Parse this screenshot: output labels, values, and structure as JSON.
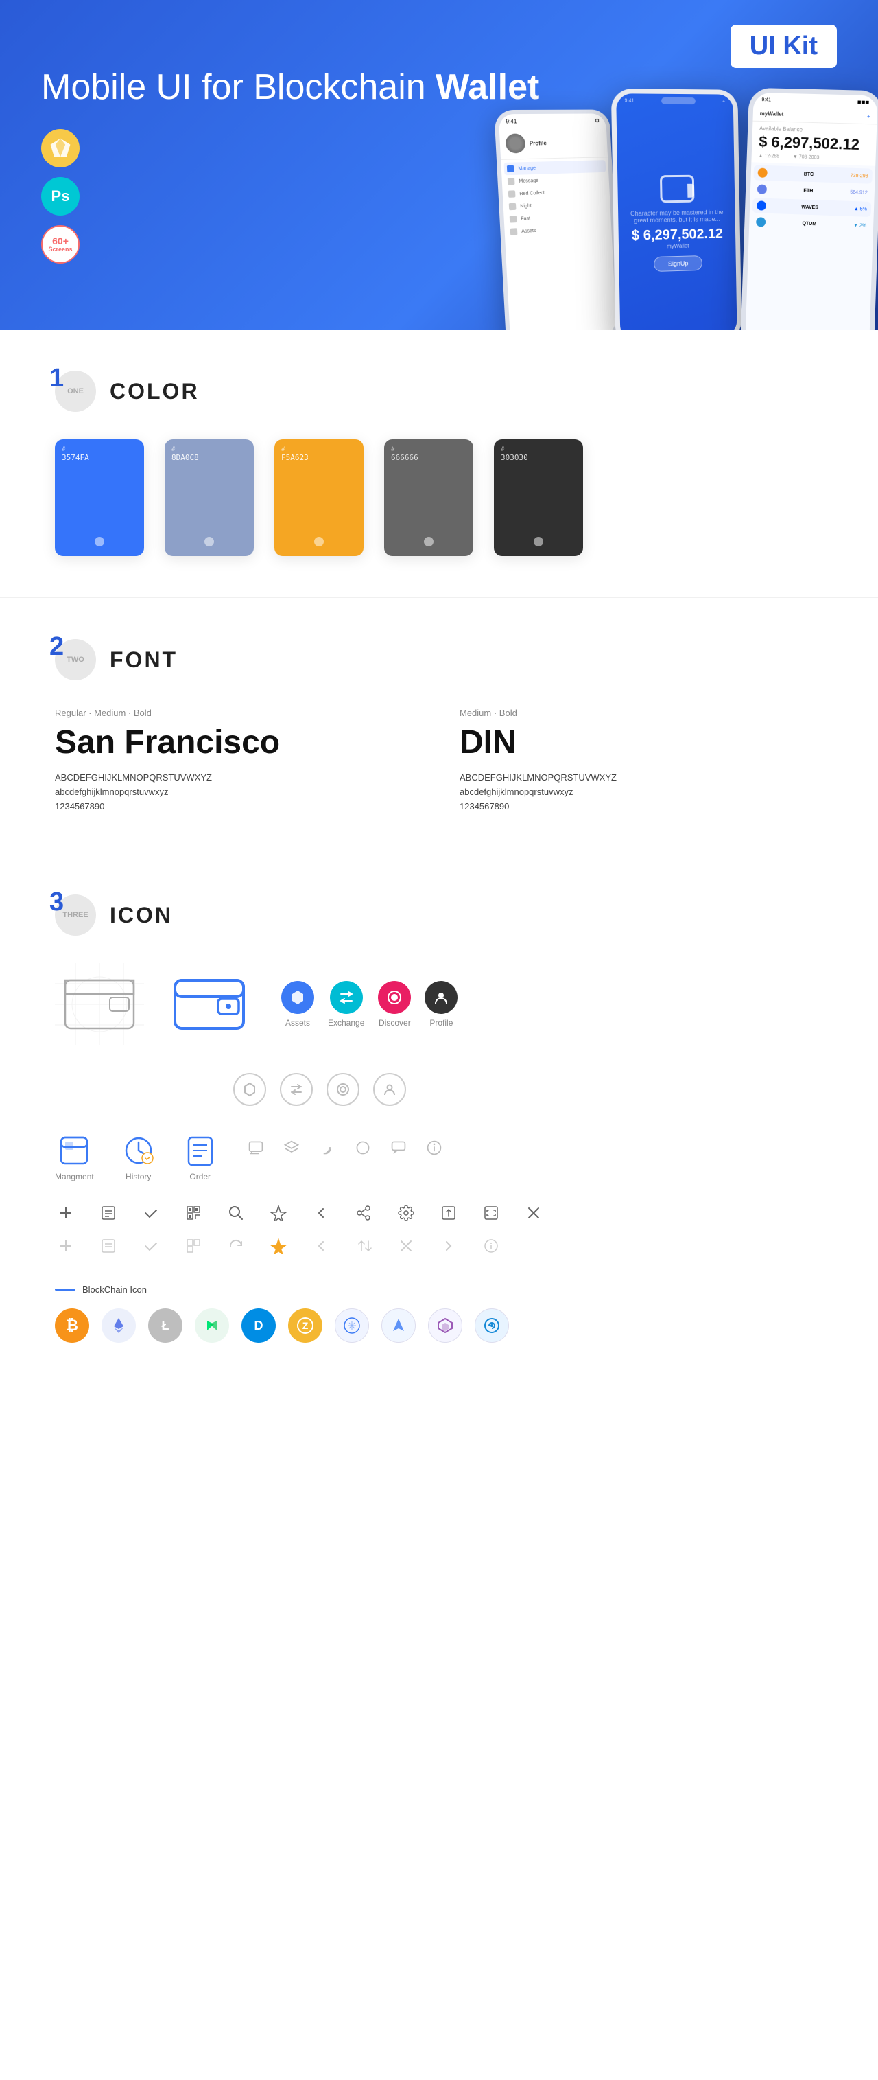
{
  "hero": {
    "title_part1": "Mobile UI for Blockchain ",
    "title_bold": "Wallet",
    "uikit_label": "UI Kit",
    "badge_sketch": "Sk",
    "badge_ps": "Ps",
    "badge_screens_num": "60+",
    "badge_screens_label": "Screens",
    "phone_main_amount": "$ 6,297,502.12",
    "phone_main_wallet_label": "myWallet",
    "phone_signup": "SignUp"
  },
  "sections": {
    "color": {
      "number": "1",
      "word": "ONE",
      "title": "COLOR",
      "swatches": [
        {
          "hex": "#3574FA",
          "label": "#\n3574FA",
          "bg": "#3574FA"
        },
        {
          "hex": "#8DA0C8",
          "label": "#\n8DA0C8",
          "bg": "#8DA0C8"
        },
        {
          "hex": "#F5A623",
          "label": "#\nF5A623",
          "bg": "#F5A623"
        },
        {
          "hex": "#666666",
          "label": "#\n666666",
          "bg": "#666666"
        },
        {
          "hex": "#303030",
          "label": "#\n303030",
          "bg": "#303030"
        }
      ]
    },
    "font": {
      "number": "2",
      "word": "TWO",
      "title": "FONT",
      "fonts": [
        {
          "style": "Regular · Medium · Bold",
          "name": "San Francisco",
          "upper": "ABCDEFGHIJKLMNOPQRSTUVWXYZ",
          "lower": "abcdefghijklmnopqrstuvwxyz",
          "nums": "1234567890"
        },
        {
          "style": "Medium · Bold",
          "name": "DIN",
          "upper": "ABCDEFGHIJKLMNOPQRSTUVWXYZ",
          "lower": "abcdefghijklmnopqrstuvwxyz",
          "nums": "1234567890"
        }
      ]
    },
    "icon": {
      "number": "3",
      "word": "THREE",
      "title": "ICON",
      "nav_icons": [
        {
          "label": "Mangment"
        },
        {
          "label": "History"
        },
        {
          "label": "Order"
        }
      ],
      "top_icons": [
        {
          "label": "Assets"
        },
        {
          "label": "Exchange"
        },
        {
          "label": "Discover"
        },
        {
          "label": "Profile"
        }
      ],
      "blockchain_label": "BlockChain Icon",
      "crypto_icons": [
        {
          "symbol": "₿",
          "class": "crypto-btc",
          "name": "Bitcoin"
        },
        {
          "symbol": "Ξ",
          "class": "crypto-eth",
          "name": "Ethereum"
        },
        {
          "symbol": "Ł",
          "class": "crypto-ltc",
          "name": "Litecoin"
        },
        {
          "symbol": "N",
          "class": "crypto-neo",
          "name": "Neo"
        },
        {
          "symbol": "D",
          "class": "crypto-dash",
          "name": "Dash"
        },
        {
          "symbol": "Z",
          "class": "crypto-zcash",
          "name": "Zcash"
        },
        {
          "symbol": "◆",
          "class": "crypto-iota",
          "name": "IOTA"
        },
        {
          "symbol": "▲",
          "class": "crypto-ark",
          "name": "Ark"
        },
        {
          "symbol": "P",
          "class": "crypto-polymath",
          "name": "Polymath"
        },
        {
          "symbol": "S",
          "class": "crypto-stratis",
          "name": "Stratis"
        }
      ]
    }
  }
}
